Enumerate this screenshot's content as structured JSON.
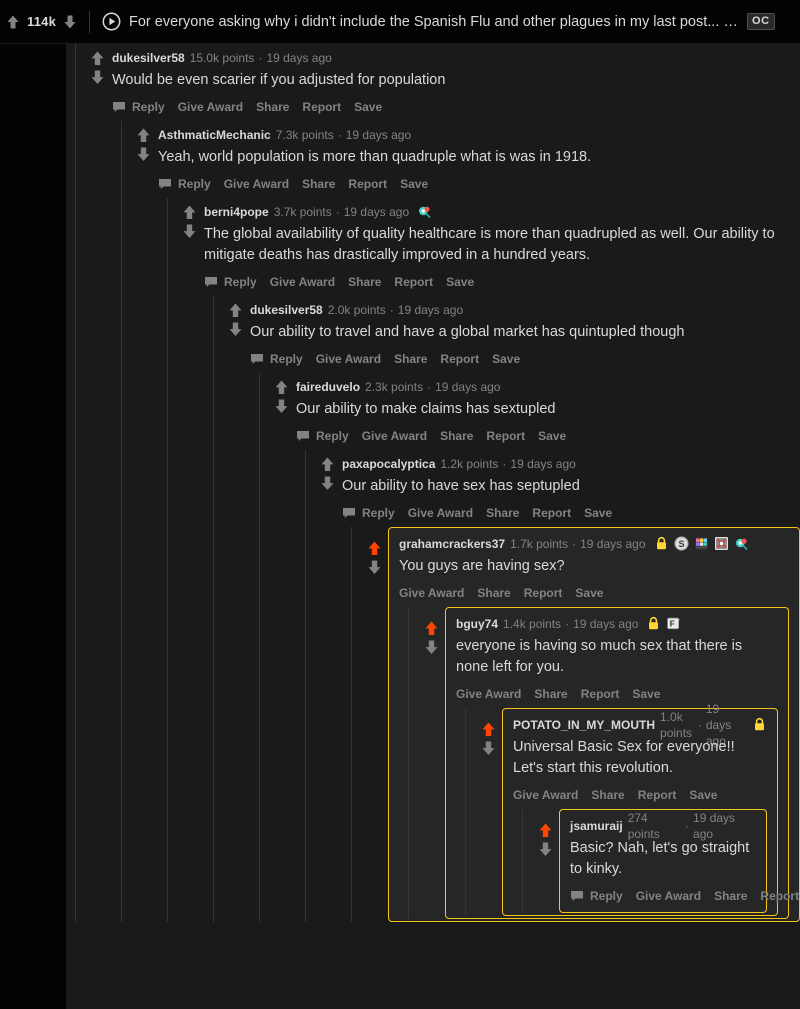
{
  "header": {
    "score": "114k",
    "upvote_icon": "arrow-up-icon",
    "downvote_icon": "arrow-down-icon",
    "play_icon": "play-circle-icon",
    "title": "For everyone asking why i didn't include the Spanish Flu and other plagues in my last post... [OC]",
    "oc_badge": "OC"
  },
  "colors": {
    "background": "#030303",
    "content_background": "#1a1a1b",
    "text": "#d7dadc",
    "muted_text": "#818384",
    "thread_line": "#343536",
    "highlight_border": "#f5c518",
    "highlight_background": "#262627",
    "upvote_active": "#ff4500",
    "vote_inactive": "#818384"
  },
  "actions": {
    "reply": "Reply",
    "give_award": "Give Award",
    "share": "Share",
    "report": "Report",
    "save": "Save"
  },
  "comments": [
    {
      "author": "dukesilver58",
      "points": "15.0k points",
      "separator": "·",
      "age": "19 days ago",
      "text": "Would be even scarier if you adjusted for population",
      "depth": 0,
      "highlighted": false,
      "has_reply": true,
      "upvoted": false,
      "awards": []
    },
    {
      "author": "AsthmaticMechanic",
      "points": "7.3k points",
      "separator": "·",
      "age": "19 days ago",
      "text": "Yeah, world population is more than quadruple what is was in 1918.",
      "depth": 1,
      "highlighted": false,
      "has_reply": true,
      "upvoted": false,
      "awards": []
    },
    {
      "author": "berni4pope",
      "points": "3.7k points",
      "separator": "·",
      "age": "19 days ago",
      "text": "The global availability of quality healthcare is more than quadrupled as well. Our ability to mitigate deaths has drastically improved in a hundred years.",
      "depth": 2,
      "highlighted": false,
      "has_reply": true,
      "upvoted": false,
      "awards": [
        "helpful-award-icon"
      ]
    },
    {
      "author": "dukesilver58",
      "points": "2.0k points",
      "separator": "·",
      "age": "19 days ago",
      "text": "Our ability to travel and have a global market has quintupled though",
      "depth": 3,
      "highlighted": false,
      "has_reply": true,
      "upvoted": false,
      "awards": []
    },
    {
      "author": "faireduvelo",
      "points": "2.3k points",
      "separator": "·",
      "age": "19 days ago",
      "text": "Our ability to make claims has sextupled",
      "depth": 4,
      "highlighted": false,
      "has_reply": true,
      "upvoted": false,
      "awards": []
    },
    {
      "author": "paxapocalyptica",
      "points": "1.2k points",
      "separator": "·",
      "age": "19 days ago",
      "text": "Our ability to have sex has septupled",
      "depth": 5,
      "highlighted": false,
      "has_reply": true,
      "upvoted": false,
      "awards": []
    },
    {
      "author": "grahamcrackers37",
      "points": "1.7k points",
      "separator": "·",
      "age": "19 days ago",
      "text": "You guys are having sex?",
      "depth": 6,
      "highlighted": true,
      "has_reply": false,
      "upvoted": true,
      "awards": [
        "gold-lock-award-icon",
        "silver-award-icon",
        "pixel-award-icon",
        "pixel-award-2-icon",
        "helpful-award-icon"
      ]
    },
    {
      "author": "bguy74",
      "points": "1.4k points",
      "separator": "·",
      "age": "19 days ago",
      "text": "everyone is having so much sex that there is none left for you.",
      "depth": 7,
      "highlighted": true,
      "has_reply": false,
      "upvoted": true,
      "awards": [
        "gold-lock-award-icon",
        "press-f-award-icon"
      ]
    },
    {
      "author": "POTATO_IN_MY_MOUTH",
      "points": "1.0k points",
      "separator": "·",
      "age": "19 days ago",
      "text": "Universal Basic Sex for everyone!! Let's start this revolution.",
      "depth": 8,
      "highlighted": true,
      "has_reply": false,
      "upvoted": true,
      "awards": [
        "gold-lock-award-icon"
      ]
    },
    {
      "author": "jsamuraij",
      "points": "274 points",
      "separator": "·",
      "age": "19 days ago",
      "text": "Basic? Nah, let's go straight to kinky.",
      "depth": 9,
      "highlighted": false,
      "has_reply": true,
      "upvoted": true,
      "awards": []
    }
  ]
}
